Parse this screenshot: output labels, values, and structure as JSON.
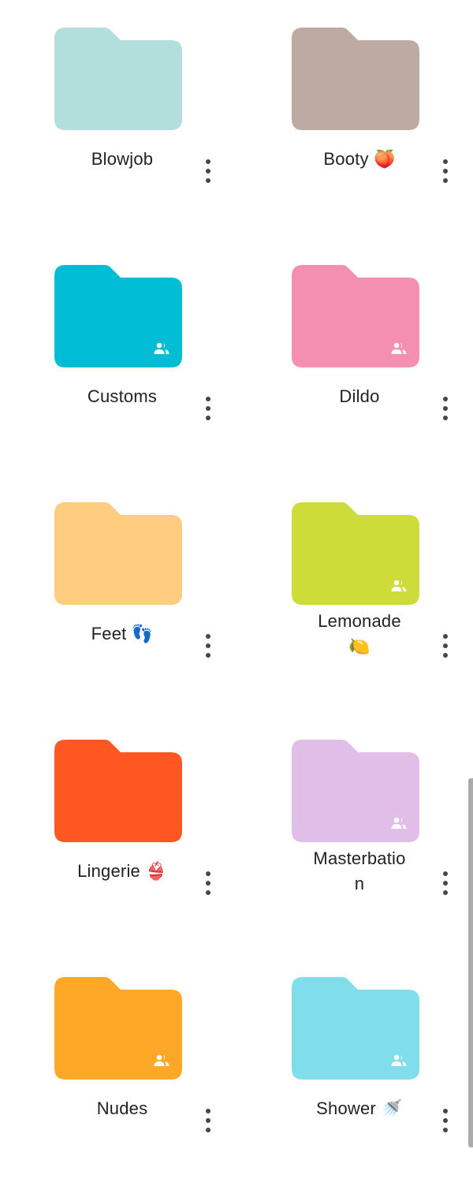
{
  "folders": [
    {
      "name": "Blowjob",
      "label_line2": "",
      "color": "#b2dfdc",
      "shared": false
    },
    {
      "name": "Booty 🍑",
      "label_line2": "",
      "color": "#bcaaa3",
      "shared": false
    },
    {
      "name": "Customs",
      "label_line2": "",
      "color": "#00bcd5",
      "shared": true
    },
    {
      "name": "Dildo",
      "label_line2": "",
      "color": "#f48fb1",
      "shared": true
    },
    {
      "name": "Feet 👣",
      "label_line2": "",
      "color": "#ffcc80",
      "shared": false
    },
    {
      "name": "Lemonade",
      "label_line2": "🍋",
      "color": "#cddc39",
      "shared": true
    },
    {
      "name": "Lingerie 👙",
      "label_line2": "",
      "color": "#ff5722",
      "shared": false
    },
    {
      "name": "Masterbatio",
      "label_line2": "n",
      "color": "#e1bee7",
      "shared": true
    },
    {
      "name": "Nudes",
      "label_line2": "",
      "color": "#ffa726",
      "shared": true
    },
    {
      "name": "Shower 🚿",
      "label_line2": "",
      "color": "#80deea",
      "shared": true
    }
  ],
  "icons": {
    "folder": "folder-icon",
    "shared": "shared-people-icon",
    "menu": "more-vert-icon"
  },
  "colors": {
    "label_text": "#222222",
    "menu_dots": "#444746",
    "shared_badge": "#ffffff",
    "scrollbar": "#ababab"
  }
}
